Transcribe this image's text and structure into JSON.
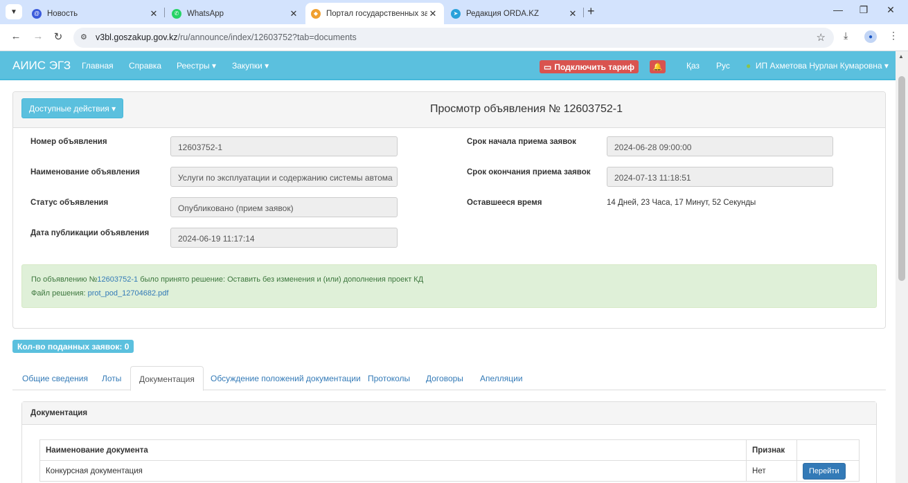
{
  "browser": {
    "tabs": [
      {
        "title": "Новость",
        "active": false,
        "favicon_color": "#3b5bdb",
        "icon": "news-icon"
      },
      {
        "title": "WhatsApp",
        "active": false,
        "favicon_color": "#25d366",
        "icon": "whatsapp-icon"
      },
      {
        "title": "Портал государственных закуп",
        "active": true,
        "favicon_color": "#f0a030",
        "icon": "portal-icon"
      },
      {
        "title": "Редакция ORDA.KZ",
        "active": false,
        "favicon_color": "#2aa1da",
        "icon": "telegram-icon"
      }
    ],
    "url_host": "v3bl.goszakup.gov.kz",
    "url_path": "/ru/announce/index/12603752?tab=documents"
  },
  "navbar": {
    "brand": "АИИС ЭГЗ",
    "items": [
      "Главная",
      "Справка",
      "Реестры ▾",
      "Закупки ▾"
    ],
    "tarif_button": "Подключить тариф",
    "lang_kz": "Қаз",
    "lang_ru": "Рус",
    "user": "ИП Ахметова Нурлан Кумаровна ▾",
    "color": "#5bc0de"
  },
  "panel": {
    "actions_button": "Доступные действия ▾",
    "title": "Просмотр объявления № 12603752-1",
    "fields": {
      "number_label": "Номер объявления",
      "number_value": "12603752-1",
      "name_label": "Наименование объявления",
      "name_value": "Услуги по эксплуатации и содержанию системы автома",
      "status_label": "Статус объявления",
      "status_value": "Опубликовано (прием заявок)",
      "pubdate_label": "Дата публикации объявления",
      "pubdate_value": "2024-06-19 11:17:14",
      "start_label": "Срок начала приема заявок",
      "start_value": "2024-06-28 09:00:00",
      "end_label": "Срок окончания приема заявок",
      "end_value": "2024-07-13 11:18:51",
      "remaining_label": "Оставшееся время",
      "remaining_value": "14 Дней, 23 Часа, 17 Минут, 52 Секунды"
    },
    "alert": {
      "line1_prefix": "По объявлению №",
      "line1_link": "12603752-1",
      "line1_suffix": " было принято решение: Оставить без изменения и (или) дополнения проект КД",
      "line2_prefix": "Файл решения: ",
      "line2_link": "prot_pod_12704682.pdf"
    }
  },
  "count_badge": "Кол-во поданных заявок: 0",
  "tabs": [
    "Общие сведения",
    "Лоты",
    "Документация",
    "Обсуждение положений документации",
    "Протоколы",
    "Договоры",
    "Апелляции"
  ],
  "documents": {
    "header": "Документация",
    "col_name": "Наименование документа",
    "col_flag": "Признак",
    "rows": [
      {
        "name": "Конкурсная документация",
        "flag": "Нет",
        "action": "Перейти"
      }
    ]
  }
}
